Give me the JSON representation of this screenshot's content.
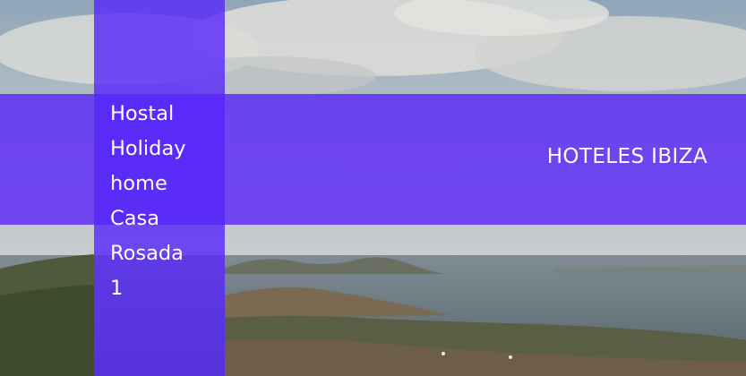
{
  "hotel": {
    "name": "Hostal Holiday home Casa Rosada 1"
  },
  "brand": {
    "link_label": "HOTELES IBIZA"
  },
  "colors": {
    "overlay_purple": "#5c28f6"
  }
}
